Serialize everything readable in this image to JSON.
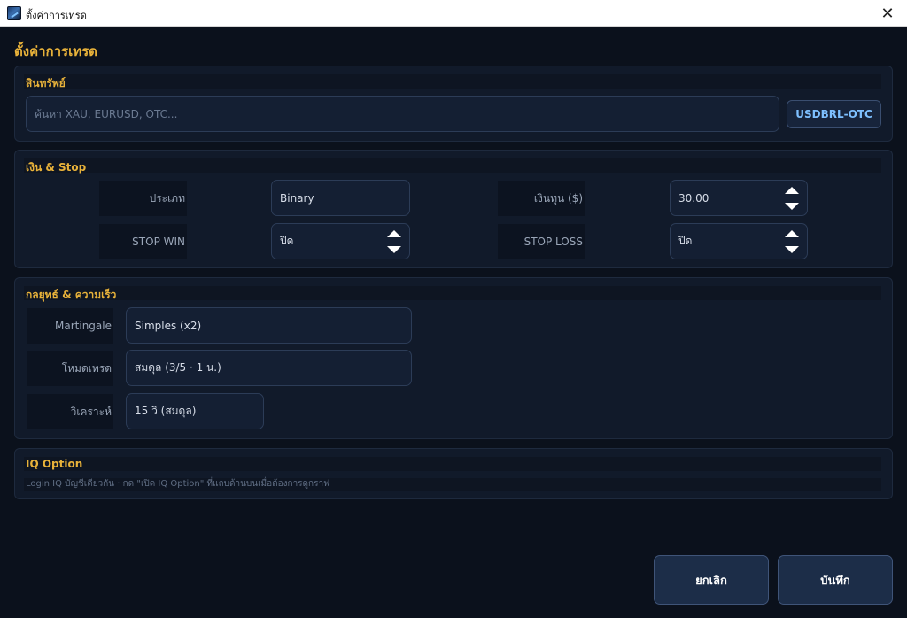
{
  "window": {
    "title": "ตั้งค่าการเทรด",
    "close_glyph": "✕",
    "icon": "app-chart-icon"
  },
  "page_title": "ตั้งค่าการเทรด",
  "asset": {
    "title": "สินทรัพย์",
    "search_placeholder": "ค้นหา XAU, EURUSD, OTC...",
    "search_value": "",
    "selected_symbol": "USDBRL-OTC"
  },
  "money": {
    "title": "เงิน & Stop",
    "type_label": "ประเภท",
    "type_value": "Binary",
    "capital_label": "เงินทุน ($)",
    "capital_value": "30.00",
    "stop_win_label": "STOP WIN",
    "stop_win_value": "ปิด",
    "stop_loss_label": "STOP LOSS",
    "stop_loss_value": "ปิด"
  },
  "strategy": {
    "title": "กลยุทธ์ & ความเร็ว",
    "martingale_label": "Martingale",
    "martingale_value": "Simples (x2)",
    "mode_label": "โหมดเทรด",
    "mode_value": "สมดุล (3/5 · 1 น.)",
    "analyze_label": "วิเคราะห์",
    "analyze_value": "15 วิ (สมดุล)"
  },
  "iq": {
    "title": "IQ Option",
    "info": "Login IQ บัญชีเดียวกัน · กด \"เปิด IQ Option\" ที่แถบด้านบนเมื่อต้องการดูกราฟ"
  },
  "footer": {
    "cancel_label": "ยกเลิก",
    "save_label": "บันทึก"
  },
  "colors": {
    "accent": "#e8b23a",
    "symbol": "#7ec0ff",
    "background": "#0b111c"
  }
}
